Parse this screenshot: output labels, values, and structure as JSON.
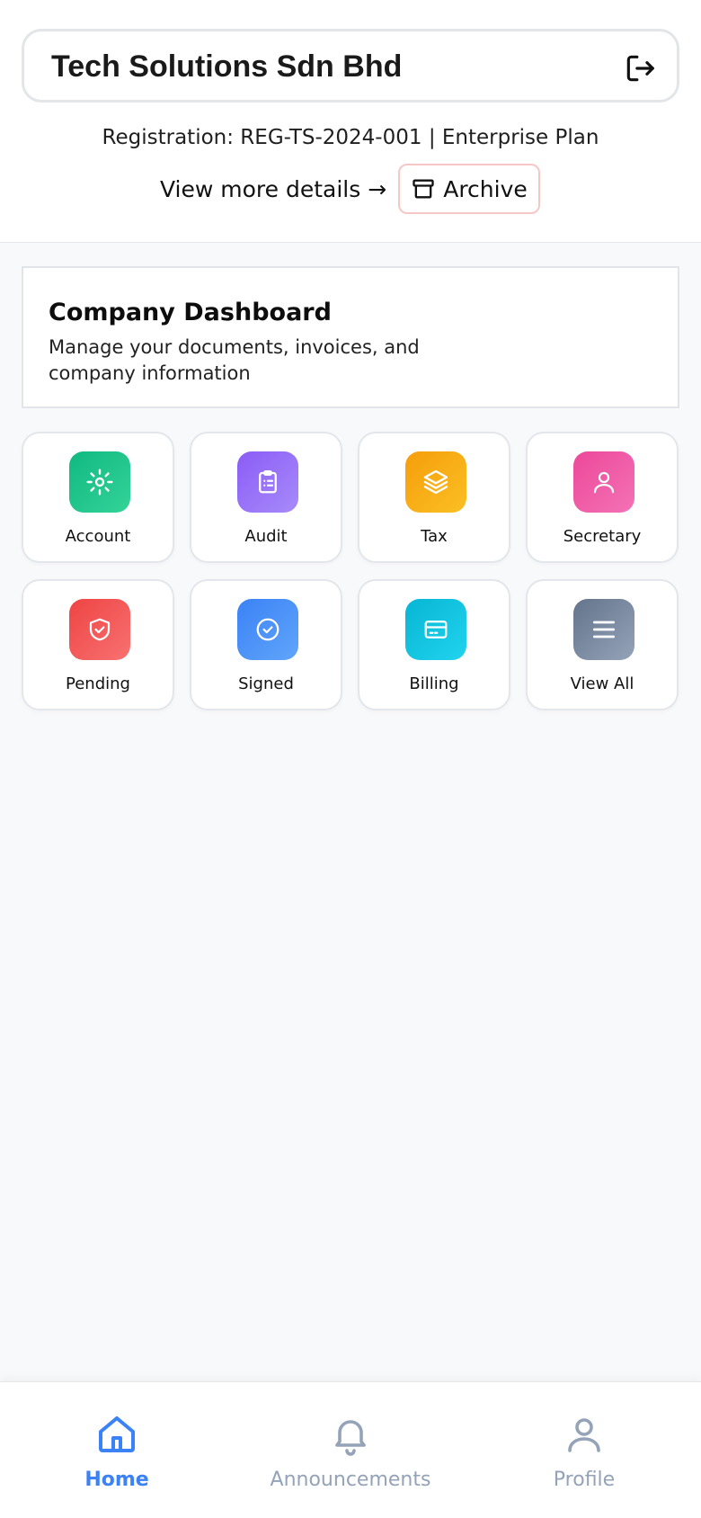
{
  "header": {
    "company_name": "Tech Solutions Sdn Bhd",
    "registration_line": "Registration: REG-TS-2024-001 | Enterprise Plan",
    "view_more_label": "View more details →",
    "archive_label": "Archive",
    "logout_icon": "logout-icon"
  },
  "dashboard": {
    "title": "Company Dashboard",
    "subtitle": "Manage your documents, invoices, and company information"
  },
  "tiles": [
    {
      "label": "Account",
      "icon": "gear-icon",
      "color_from": "#10b981",
      "color_to": "#34d399"
    },
    {
      "label": "Audit",
      "icon": "clipboard-icon",
      "color_from": "#8b5cf6",
      "color_to": "#a78bfa"
    },
    {
      "label": "Tax",
      "icon": "layers-icon",
      "color_from": "#f59e0b",
      "color_to": "#fbbf24"
    },
    {
      "label": "Secretary",
      "icon": "user-icon",
      "color_from": "#ec4899",
      "color_to": "#f472b6"
    },
    {
      "label": "Pending",
      "icon": "shield-check-icon",
      "color_from": "#ef4444",
      "color_to": "#f87171"
    },
    {
      "label": "Signed",
      "icon": "check-circle-icon",
      "color_from": "#3b82f6",
      "color_to": "#60a5fa"
    },
    {
      "label": "Billing",
      "icon": "card-icon",
      "color_from": "#06b6d4",
      "color_to": "#22d3ee"
    },
    {
      "label": "View All",
      "icon": "menu-icon",
      "color_from": "#64748b",
      "color_to": "#94a3b8"
    }
  ],
  "bottom_nav": {
    "items": [
      {
        "label": "Home",
        "icon": "home-icon",
        "active": true
      },
      {
        "label": "Announcements",
        "icon": "bell-icon",
        "active": false
      },
      {
        "label": "Profile",
        "icon": "profile-icon",
        "active": false
      }
    ],
    "active_color": "#3b82f6",
    "inactive_color": "#94a3b8"
  }
}
